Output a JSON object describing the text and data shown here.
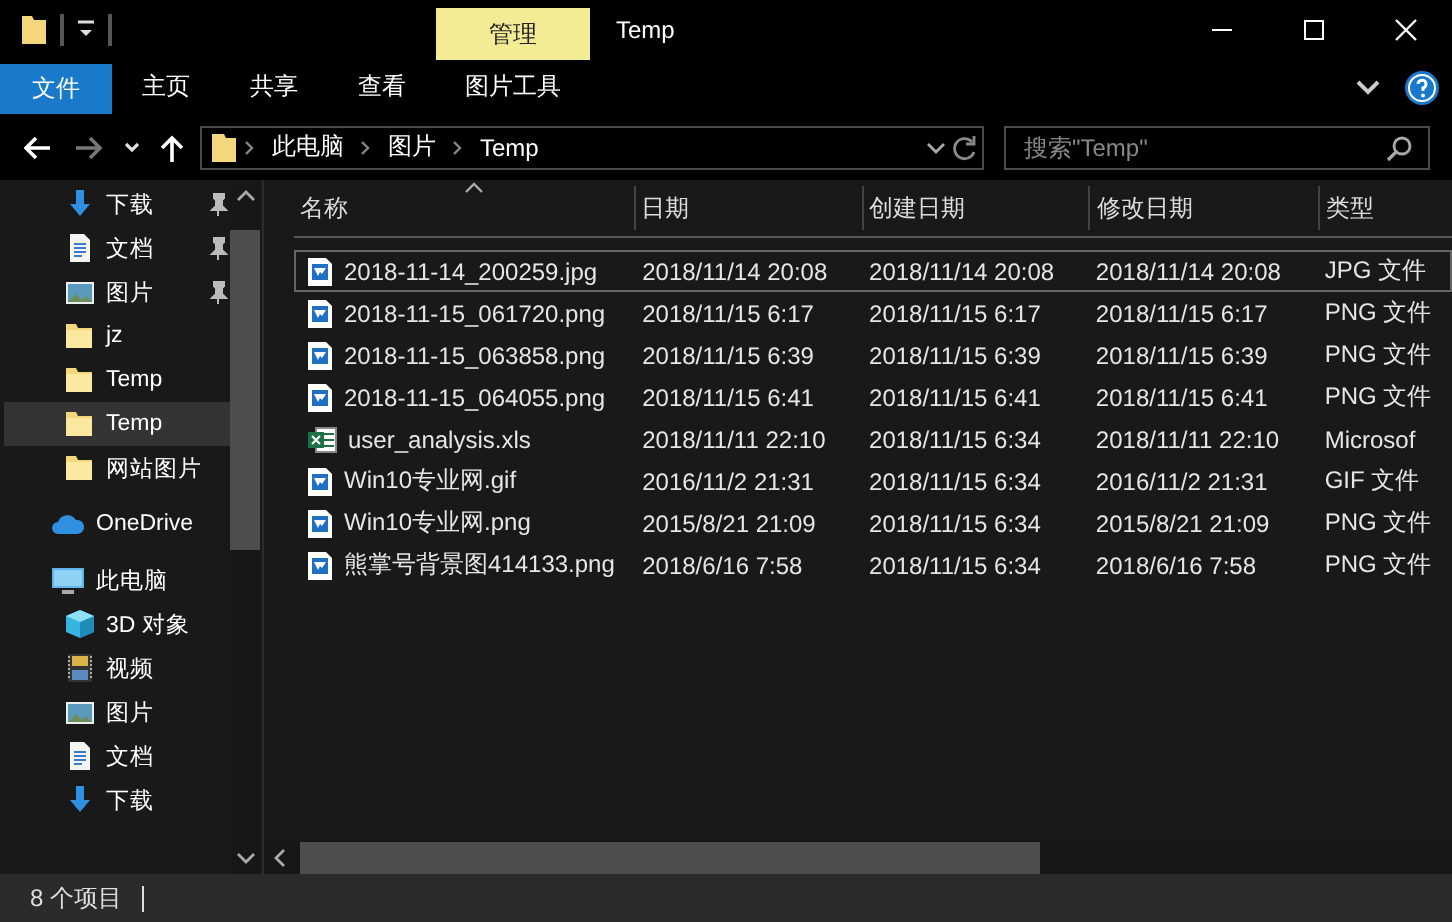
{
  "window": {
    "title": "Temp",
    "context_tab": "管理"
  },
  "ribbon_tabs": [
    {
      "label": "文件",
      "kind": "file"
    },
    {
      "label": "主页",
      "kind": "plain"
    },
    {
      "label": "共享",
      "kind": "plain"
    },
    {
      "label": "查看",
      "kind": "plain"
    },
    {
      "label": "图片工具",
      "kind": "context"
    }
  ],
  "address": {
    "path": [
      "此电脑",
      "图片",
      "Temp"
    ]
  },
  "search": {
    "placeholder": "搜索\"Temp\""
  },
  "nav": {
    "quick_access": [
      {
        "label": "下载",
        "kind": "download",
        "pinned": true,
        "selected": false
      },
      {
        "label": "文档",
        "kind": "document",
        "pinned": true,
        "selected": false
      },
      {
        "label": "图片",
        "kind": "picture",
        "pinned": true,
        "selected": false
      },
      {
        "label": "jz",
        "kind": "folder",
        "pinned": false,
        "selected": false
      },
      {
        "label": "Temp",
        "kind": "folder",
        "pinned": false,
        "selected": false
      },
      {
        "label": "Temp",
        "kind": "folder",
        "pinned": false,
        "selected": true
      },
      {
        "label": "网站图片",
        "kind": "folder",
        "pinned": false,
        "selected": false
      }
    ],
    "roots": [
      {
        "label": "OneDrive",
        "kind": "cloud"
      },
      {
        "label": "此电脑",
        "kind": "pc",
        "children": [
          {
            "label": "3D 对象",
            "kind": "cube"
          },
          {
            "label": "视频",
            "kind": "video"
          },
          {
            "label": "图片",
            "kind": "picture"
          },
          {
            "label": "文档",
            "kind": "document"
          },
          {
            "label": "下载",
            "kind": "download"
          }
        ]
      }
    ]
  },
  "table": {
    "columns": [
      {
        "label": "名称",
        "sorted": true
      },
      {
        "label": "日期",
        "sorted": false
      },
      {
        "label": "创建日期",
        "sorted": false
      },
      {
        "label": "修改日期",
        "sorted": false
      },
      {
        "label": "类型",
        "sorted": false
      }
    ],
    "rows": [
      {
        "kind": "image",
        "focused": true,
        "cells": [
          "2018-11-14_200259.jpg",
          "2018/11/14 20:08",
          "2018/11/14 20:08",
          "2018/11/14 20:08",
          "JPG 文件"
        ]
      },
      {
        "kind": "image",
        "focused": false,
        "cells": [
          "2018-11-15_061720.png",
          "2018/11/15 6:17",
          "2018/11/15 6:17",
          "2018/11/15 6:17",
          "PNG 文件"
        ]
      },
      {
        "kind": "image",
        "focused": false,
        "cells": [
          "2018-11-15_063858.png",
          "2018/11/15 6:39",
          "2018/11/15 6:39",
          "2018/11/15 6:39",
          "PNG 文件"
        ]
      },
      {
        "kind": "image",
        "focused": false,
        "cells": [
          "2018-11-15_064055.png",
          "2018/11/15 6:41",
          "2018/11/15 6:41",
          "2018/11/15 6:41",
          "PNG 文件"
        ]
      },
      {
        "kind": "sheet",
        "focused": false,
        "cells": [
          "user_analysis.xls",
          "2018/11/11 22:10",
          "2018/11/15 6:34",
          "2018/11/11 22:10",
          "Microsof"
        ]
      },
      {
        "kind": "image",
        "focused": false,
        "cells": [
          "Win10专业网.gif",
          "2016/11/2 21:31",
          "2018/11/15 6:34",
          "2016/11/2 21:31",
          "GIF 文件"
        ]
      },
      {
        "kind": "image",
        "focused": false,
        "cells": [
          "Win10专业网.png",
          "2015/8/21 21:09",
          "2018/11/15 6:34",
          "2015/8/21 21:09",
          "PNG 文件"
        ]
      },
      {
        "kind": "image",
        "focused": false,
        "cells": [
          "熊掌号背景图414133.png",
          "2018/6/16 7:58",
          "2018/11/15 6:34",
          "2018/6/16 7:58",
          "PNG 文件"
        ]
      }
    ]
  },
  "status_bar": {
    "count": "8 个项目"
  }
}
